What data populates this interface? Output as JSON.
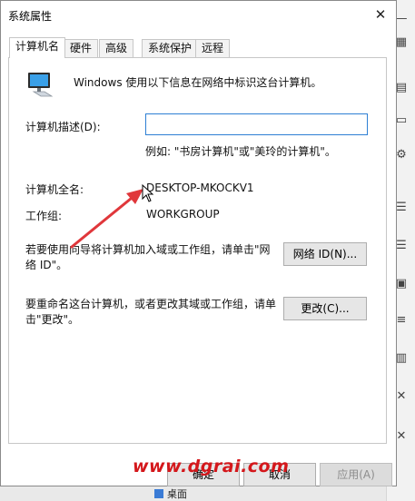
{
  "window": {
    "title": "系统属性",
    "close_label": "✕"
  },
  "tabs": [
    {
      "label": "计算机名",
      "active": true
    },
    {
      "label": "硬件",
      "active": false
    },
    {
      "label": "高级",
      "active": false
    },
    {
      "label": "系统保护",
      "active": false
    },
    {
      "label": "远程",
      "active": false
    }
  ],
  "info": {
    "icon": "computer-icon",
    "text": "Windows 使用以下信息在网络中标识这台计算机。"
  },
  "description": {
    "label": "计算机描述(D):",
    "value": "",
    "hint": "例如: \"书房计算机\"或\"美玲的计算机\"。"
  },
  "full_name": {
    "label": "计算机全名:",
    "value": "DESKTOP-MKOCKV1"
  },
  "workgroup": {
    "label": "工作组:",
    "value": "WORKGROUP"
  },
  "network_id": {
    "text": "若要使用向导将计算机加入域或工作组，请单击\"网络 ID\"。",
    "button": "网络 ID(N)..."
  },
  "rename": {
    "text": "要重命名这台计算机，或者更改其域或工作组，请单击\"更改\"。",
    "button": "更改(C)..."
  },
  "footer": {
    "ok": "确定",
    "cancel": "取消",
    "apply": "应用(A)"
  },
  "background": {
    "taskbar_item": "桌面"
  },
  "watermark": "www.dgrai.com",
  "colors": {
    "accent": "#2d7fd4",
    "arrow": "#e0373b",
    "watermark": "#d4171b"
  }
}
